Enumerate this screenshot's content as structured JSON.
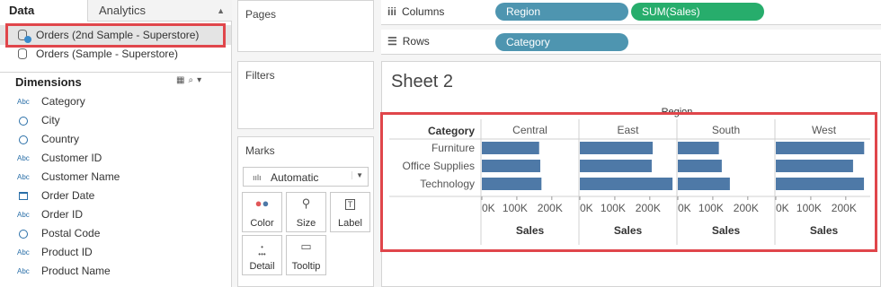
{
  "left_panel": {
    "tabs": {
      "data": "Data",
      "analytics": "Analytics"
    },
    "data_sources": [
      {
        "label": "Orders (2nd Sample - Superstore)",
        "active": true
      },
      {
        "label": "Orders (Sample - Superstore)",
        "active": false
      }
    ],
    "dimensions_title": "Dimensions",
    "fields": [
      {
        "label": "Category",
        "type": "Abc"
      },
      {
        "label": "City",
        "type": "geo"
      },
      {
        "label": "Country",
        "type": "geo"
      },
      {
        "label": "Customer ID",
        "type": "Abc"
      },
      {
        "label": "Customer Name",
        "type": "Abc"
      },
      {
        "label": "Order Date",
        "type": "date"
      },
      {
        "label": "Order ID",
        "type": "Abc"
      },
      {
        "label": "Postal Code",
        "type": "geo"
      },
      {
        "label": "Product ID",
        "type": "Abc"
      },
      {
        "label": "Product Name",
        "type": "Abc"
      }
    ]
  },
  "shelves": {
    "pages": "Pages",
    "filters": "Filters",
    "marks": "Marks",
    "mark_type": "Automatic",
    "mark_buttons": [
      "Color",
      "Size",
      "Label",
      "Detail",
      "Tooltip"
    ],
    "columns_label": "Columns",
    "rows_label": "Rows",
    "column_pills": [
      {
        "label": "Region",
        "color": "#4e95b0"
      },
      {
        "label": "SUM(Sales)",
        "color": "#27ad6c"
      }
    ],
    "row_pills": [
      {
        "label": "Category",
        "color": "#4e95b0"
      }
    ]
  },
  "sheet": {
    "title": "Sheet 2"
  },
  "chart_data": {
    "type": "bar",
    "orientation": "horizontal",
    "column_header": "Region",
    "row_header": "Category",
    "panels": [
      "Central",
      "East",
      "South",
      "West"
    ],
    "categories": [
      "Furniture",
      "Office Supplies",
      "Technology"
    ],
    "values": {
      "Central": [
        163797,
        167026,
        170416
      ],
      "East": [
        208291,
        205516,
        264974
      ],
      "South": [
        117299,
        125651,
        148772
      ],
      "West": [
        252613,
        220853,
        251992
      ]
    },
    "xticks": [
      "0K",
      "100K",
      "200K"
    ],
    "xlim": [
      0,
      275000
    ],
    "xlabel": "Sales",
    "bar_color": "#4e79a7",
    "highlight_color": "#e0464b"
  }
}
